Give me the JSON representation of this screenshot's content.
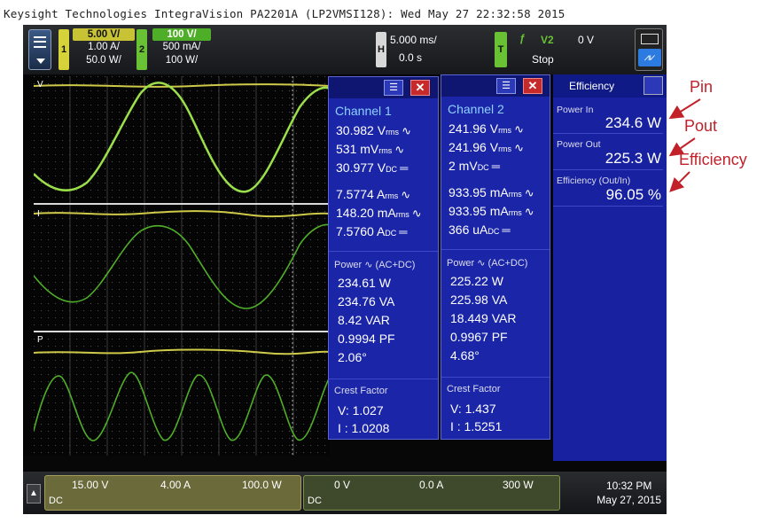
{
  "caption": "Keysight Technologies IntegraVision PA2201A (LP2VMSI128): Wed May 27 22:32:58 2015",
  "topbar": {
    "ch1": {
      "badge": "1",
      "scale": "5.00 V/",
      "row2": "1.00 A/",
      "row3": "50.0 W/",
      "color": "#d6d23a"
    },
    "ch2": {
      "badge": "2",
      "scale": "100 V/",
      "row2": "500 mA/",
      "row3": "100 W/",
      "color": "#68c234"
    },
    "horizontal": {
      "badge": "H",
      "timebase": "5.000 ms/",
      "delay": "0.0 s"
    },
    "trigger": {
      "badge": "T",
      "source": "V2",
      "level": "0 V",
      "mode": "Stop"
    }
  },
  "waveform_labels": [
    "V",
    "I",
    "P"
  ],
  "channel1": {
    "title": "Channel 1",
    "meas": [
      {
        "value": "30.982 V",
        "unit": "rms"
      },
      {
        "value": "531 mV",
        "unit": "rms"
      },
      {
        "value": "30.977 V",
        "unit": "DC"
      },
      {
        "value": "7.5774 A",
        "unit": "rms"
      },
      {
        "value": "148.20 mA",
        "unit": "rms"
      },
      {
        "value": "7.5760 A",
        "unit": "DC"
      }
    ],
    "power_label": "Power",
    "power_mode": "(AC+DC)",
    "power": [
      "234.61 W",
      "234.76 VA",
      "8.42 VAR",
      "0.9994 PF",
      "2.06°"
    ],
    "crest_label": "Crest Factor",
    "crest_v": "V:  1.027",
    "crest_i": "I :  1.0208"
  },
  "channel2": {
    "title": "Channel 2",
    "meas": [
      {
        "value": "241.96 V",
        "unit": "rms"
      },
      {
        "value": "241.96 V",
        "unit": "rms"
      },
      {
        "value": "2 mV",
        "unit": "DC"
      },
      {
        "value": "933.95 mA",
        "unit": "rms"
      },
      {
        "value": "933.95 mA",
        "unit": "rms"
      },
      {
        "value": "366 uA",
        "unit": "DC"
      }
    ],
    "power_label": "Power",
    "power_mode": "(AC+DC)",
    "power": [
      "225.22 W",
      "225.98 VA",
      "18.449 VAR",
      "0.9967 PF",
      "4.68°"
    ],
    "crest_label": "Crest Factor",
    "crest_v": "V:  1.437",
    "crest_i": "I :  1.5251"
  },
  "efficiency": {
    "title": "Efficiency",
    "power_in_label": "Power In",
    "power_in": "234.6 W",
    "power_out_label": "Power Out",
    "power_out": "225.3 W",
    "efficiency_label": "Efficiency (Out/In)",
    "efficiency": "96.05 %"
  },
  "annotations": {
    "pin": "Pin",
    "pout": "Pout",
    "efficiency": "Efficiency",
    "color": "#c3212a"
  },
  "bottombar": {
    "ch1_v": "15.00 V",
    "ch1_a": "4.00 A",
    "ch1_w": "100.0 W",
    "ch1_coupling": "DC",
    "ch2_v": "0 V",
    "ch2_a": "0.0 A",
    "ch2_w": "300 W",
    "ch2_coupling": "DC",
    "time": "10:32 PM",
    "date": "May 27, 2015"
  }
}
